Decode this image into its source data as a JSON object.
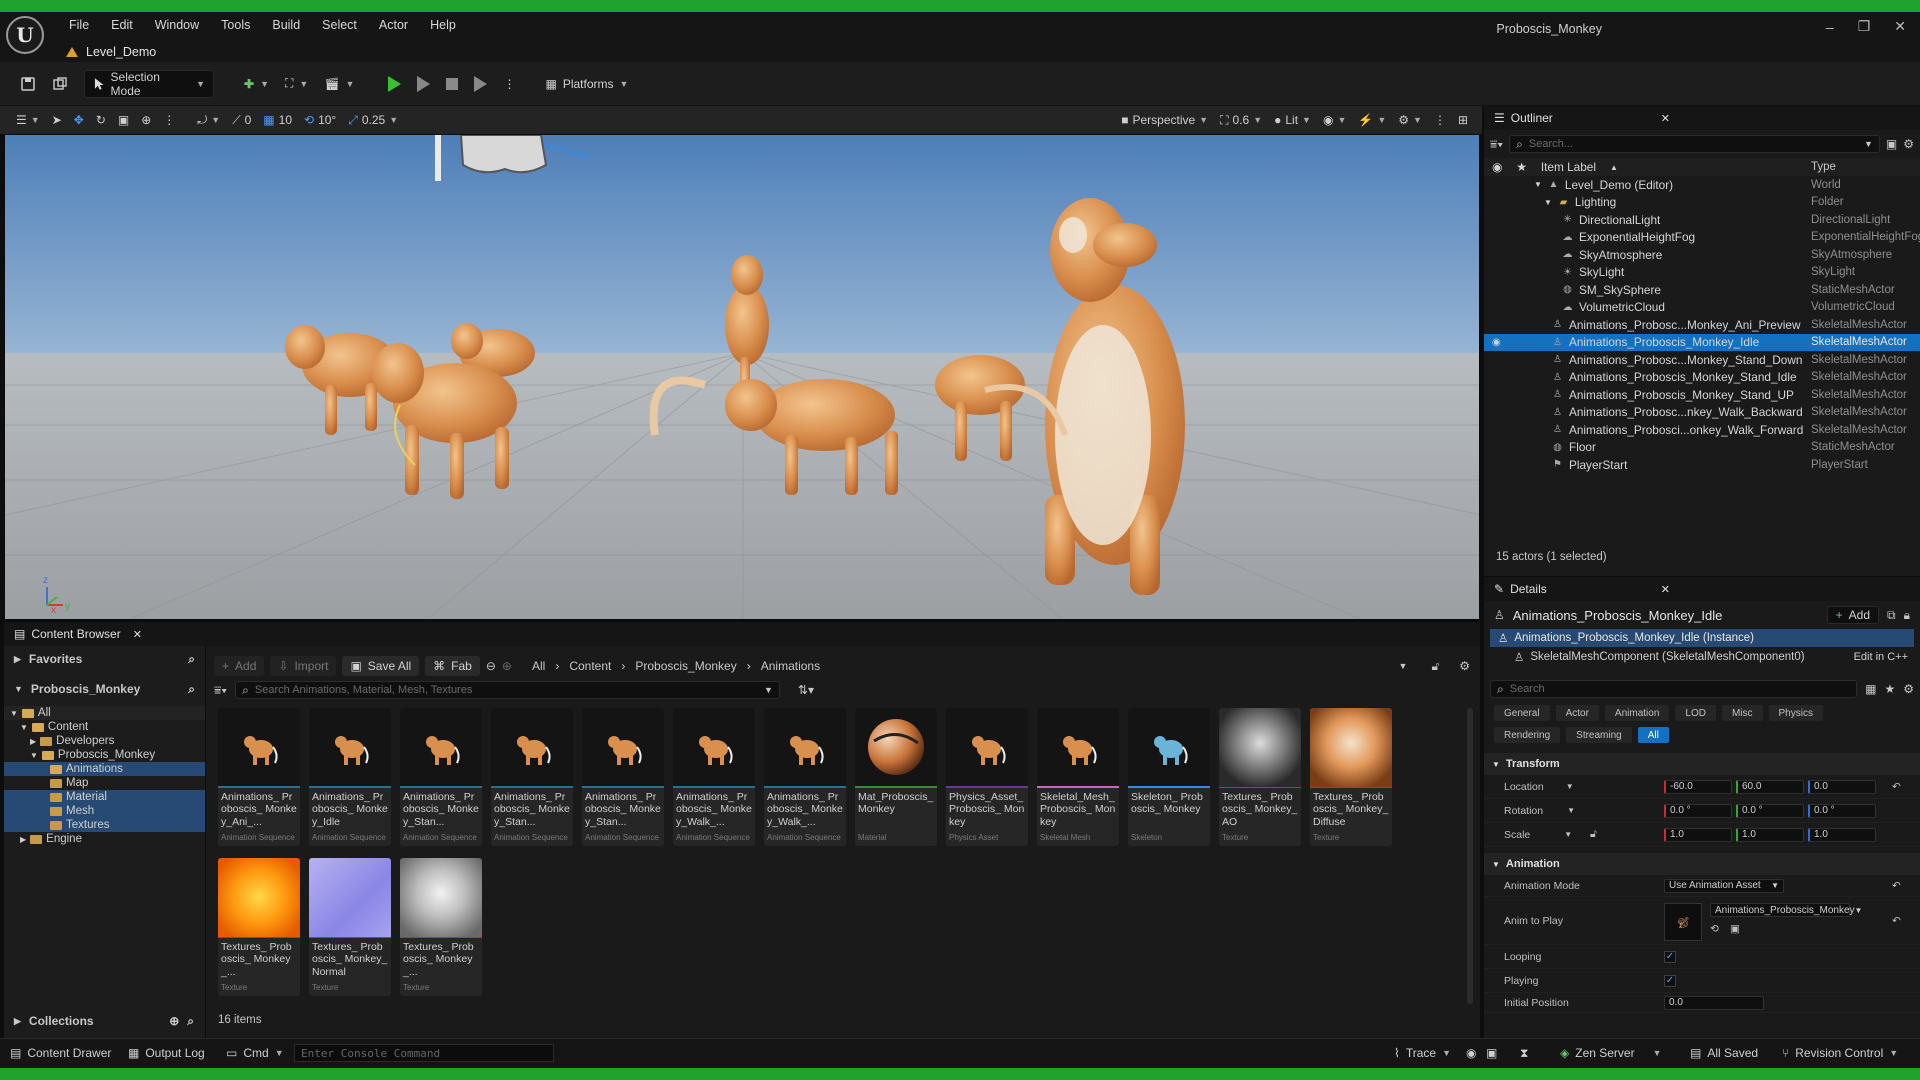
{
  "menu": [
    "File",
    "Edit",
    "Window",
    "Tools",
    "Build",
    "Select",
    "Actor",
    "Help"
  ],
  "level_tab": "Level_Demo",
  "project_name": "Proboscis_Monkey",
  "toolbar": {
    "mode": "Selection Mode",
    "platforms": "Platforms"
  },
  "viewport_toolbar": {
    "rotate_snap": "0",
    "grid_snap": "10",
    "angle_snap": "10°",
    "scale_snap": "0.25",
    "perspective": "Perspective",
    "camera_speed": "0.6",
    "lit": "Lit"
  },
  "outliner": {
    "title": "Outliner",
    "search_placeholder": "Search...",
    "col_label": "Item Label",
    "col_type": "Type",
    "rows": [
      {
        "label": "Level_Demo (Editor)",
        "type": "World"
      },
      {
        "label": "Lighting",
        "type": "Folder"
      },
      {
        "label": "DirectionalLight",
        "type": "DirectionalLight"
      },
      {
        "label": "ExponentialHeightFog",
        "type": "ExponentialHeightFog"
      },
      {
        "label": "SkyAtmosphere",
        "type": "SkyAtmosphere"
      },
      {
        "label": "SkyLight",
        "type": "SkyLight"
      },
      {
        "label": "SM_SkySphere",
        "type": "StaticMeshActor"
      },
      {
        "label": "VolumetricCloud",
        "type": "VolumetricCloud"
      },
      {
        "label": "Animations_Probosc...Monkey_Ani_Preview",
        "type": "SkeletalMeshActor"
      },
      {
        "label": "Animations_Proboscis_Monkey_Idle",
        "type": "SkeletalMeshActor"
      },
      {
        "label": "Animations_Probosc...Monkey_Stand_Down",
        "type": "SkeletalMeshActor"
      },
      {
        "label": "Animations_Proboscis_Monkey_Stand_Idle",
        "type": "SkeletalMeshActor"
      },
      {
        "label": "Animations_Proboscis_Monkey_Stand_UP",
        "type": "SkeletalMeshActor"
      },
      {
        "label": "Animations_Probosc...nkey_Walk_Backward",
        "type": "SkeletalMeshActor"
      },
      {
        "label": "Animations_Probosci...onkey_Walk_Forward",
        "type": "SkeletalMeshActor"
      },
      {
        "label": "Floor",
        "type": "StaticMeshActor"
      },
      {
        "label": "PlayerStart",
        "type": "PlayerStart"
      }
    ],
    "footer": "15 actors (1 selected)"
  },
  "details": {
    "title": "Details",
    "actor_name": "Animations_Proboscis_Monkey_Idle",
    "add": "Add",
    "instance": "Animations_Proboscis_Monkey_Idle (Instance)",
    "component": "SkeletalMeshComponent (SkeletalMeshComponent0)",
    "edit_cpp": "Edit in C++",
    "search_placeholder": "Search",
    "filters": [
      "General",
      "Actor",
      "Animation",
      "LOD",
      "Misc",
      "Physics",
      "Rendering",
      "Streaming",
      "All"
    ],
    "transform": {
      "title": "Transform",
      "location_label": "Location",
      "location": [
        "-60.0",
        "60.0",
        "0.0"
      ],
      "rotation_label": "Rotation",
      "rotation": [
        "0.0 °",
        "0.0 °",
        "0.0 °"
      ],
      "scale_label": "Scale",
      "scale": [
        "1.0",
        "1.0",
        "1.0"
      ]
    },
    "animation": {
      "title": "Animation",
      "mode_label": "Animation Mode",
      "mode": "Use Animation Asset",
      "anim_label": "Anim to Play",
      "anim": "Animations_Proboscis_Monkey",
      "looping_label": "Looping",
      "playing_label": "Playing",
      "initial_label": "Initial Position",
      "initial": "0.0"
    }
  },
  "content_browser": {
    "title": "Content Browser",
    "favorites": "Favorites",
    "project": "Proboscis_Monkey",
    "tree": [
      "All",
      "Content",
      "Developers",
      "Proboscis_Monkey",
      "Animations",
      "Map",
      "Material",
      "Mesh",
      "Textures",
      "Engine"
    ],
    "collections": "Collections",
    "add": "Add",
    "import": "Import",
    "save_all": "Save All",
    "fab": "Fab",
    "breadcrumb": [
      "All",
      "Content",
      "Proboscis_Monkey",
      "Animations"
    ],
    "search_placeholder": "Search Animations, Material, Mesh, Textures",
    "count": "16 items",
    "assets": [
      {
        "name": "Animations_ Proboscis_ Monkey_Ani_...",
        "type": "Animation Sequence"
      },
      {
        "name": "Animations_ Proboscis_ Monkey_Idle",
        "type": "Animation Sequence"
      },
      {
        "name": "Animations_ Proboscis_ Monkey_Stan...",
        "type": "Animation Sequence"
      },
      {
        "name": "Animations_ Proboscis_ Monkey_Stan...",
        "type": "Animation Sequence"
      },
      {
        "name": "Animations_ Proboscis_ Monkey_Stan...",
        "type": "Animation Sequence"
      },
      {
        "name": "Animations_ Proboscis_ Monkey_Walk_...",
        "type": "Animation Sequence"
      },
      {
        "name": "Animations_ Proboscis_ Monkey_Walk_...",
        "type": "Animation Sequence"
      },
      {
        "name": "Mat_Proboscis_ Monkey",
        "type": "Material"
      },
      {
        "name": "Physics_Asset_ Proboscis_ Monkey",
        "type": "Physics Asset"
      },
      {
        "name": "Skeletal_Mesh_ Proboscis_ Monkey",
        "type": "Skeletal Mesh"
      },
      {
        "name": "Skeleton_ Proboscis_ Monkey",
        "type": "Skeleton"
      },
      {
        "name": "Textures_ Proboscis_ Monkey_AO",
        "type": "Texture"
      },
      {
        "name": "Textures_ Proboscis_ Monkey_Diffuse",
        "type": "Texture"
      },
      {
        "name": "Textures_ Proboscis_ Monkey_...",
        "type": "Texture"
      },
      {
        "name": "Textures_ Proboscis_ Monkey_Normal",
        "type": "Texture"
      },
      {
        "name": "Textures_ Proboscis_ Monkey_...",
        "type": "Texture"
      }
    ]
  },
  "statusbar": {
    "content_drawer": "Content Drawer",
    "output_log": "Output Log",
    "cmd": "Cmd",
    "console_placeholder": "Enter Console Command",
    "trace": "Trace",
    "zen": "Zen Server",
    "saved": "All Saved",
    "revision": "Revision Control"
  },
  "colors": {
    "accent": "#1470c0",
    "play": "#38c22f",
    "frame": "#1fa22e"
  }
}
